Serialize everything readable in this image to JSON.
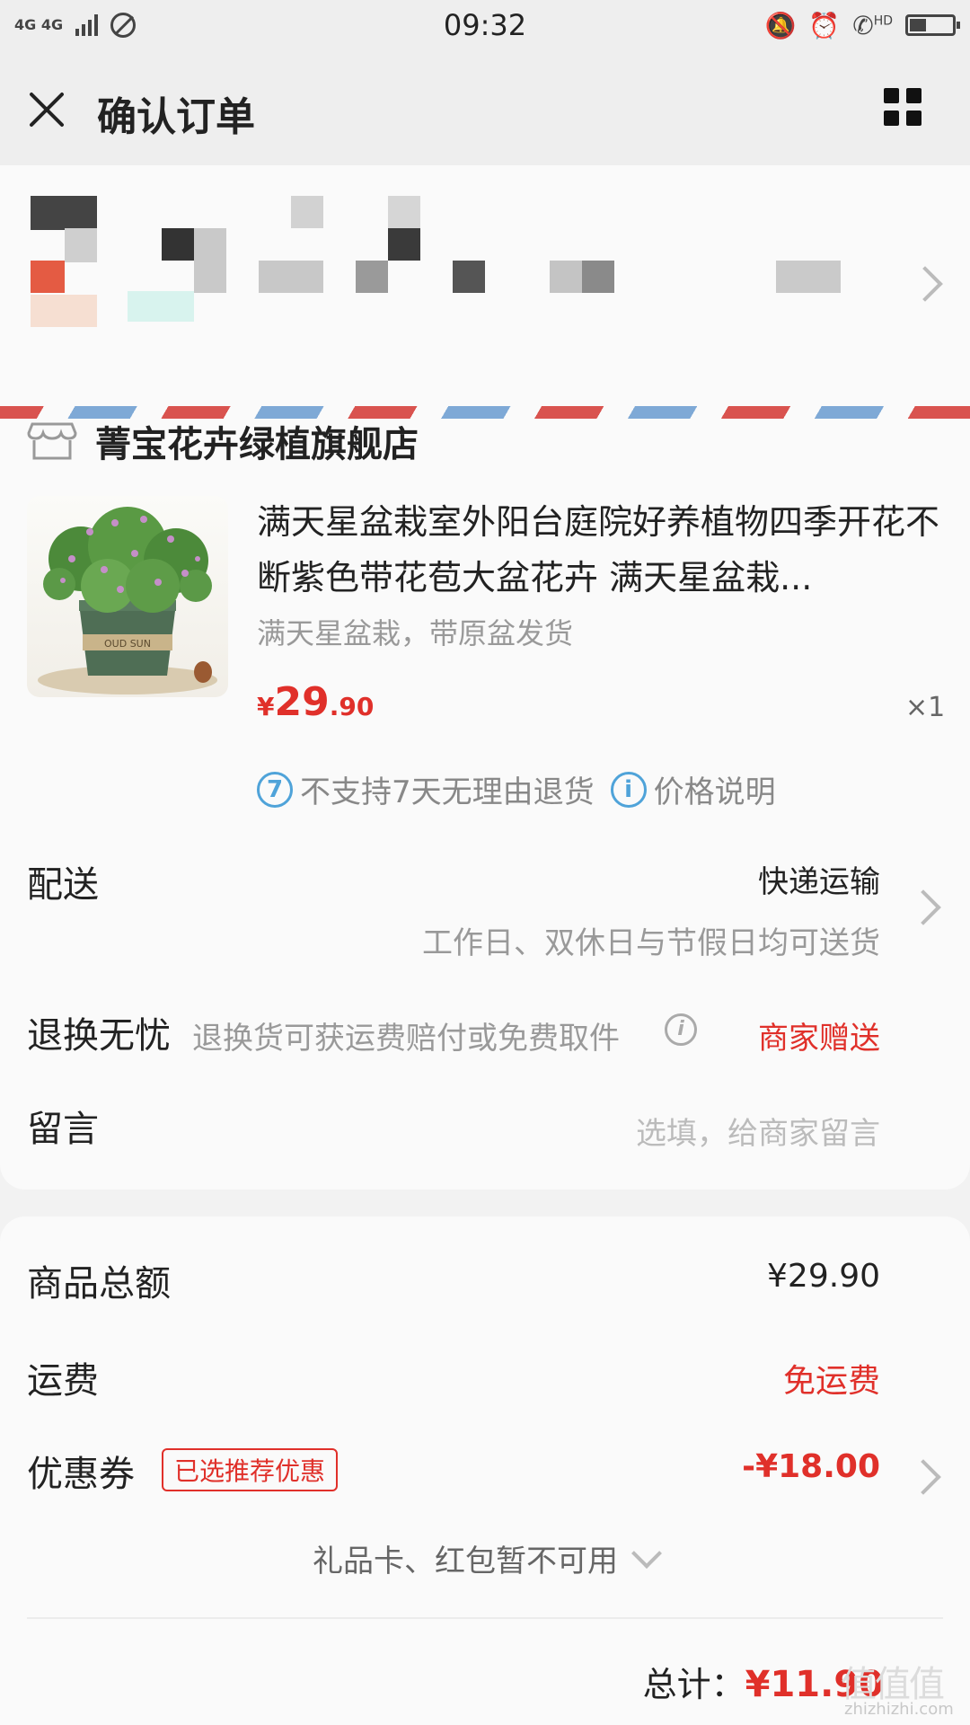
{
  "status_bar": {
    "network": "4G 4G",
    "time": "09:32",
    "hd": "HD"
  },
  "header": {
    "title": "确认订单"
  },
  "shop": {
    "name": "菁宝花卉绿植旗舰店"
  },
  "product": {
    "title": "满天星盆栽室外阳台庭院好养植物四季开花不断紫色带花苞大盆花卉 满天星盆栽...",
    "sku": "满天星盆栽，带原盆发货",
    "price_currency": "¥",
    "price_int": "29",
    "price_dec": ".90",
    "quantity": "×1",
    "pot_text": "OUD SUN"
  },
  "services": [
    {
      "label": "不支持7天无理由退货",
      "icon": "no-return-icon"
    },
    {
      "label": "价格说明",
      "icon": "info-icon"
    }
  ],
  "delivery": {
    "label": "配送",
    "method": "快递运输",
    "note": "工作日、双休日与节假日均可送货"
  },
  "returns": {
    "label": "退换无忧",
    "desc": "退换货可获运费赔付或免费取件",
    "badge": "商家赠送"
  },
  "message": {
    "label": "留言",
    "placeholder": "选填，给商家留言"
  },
  "summary": {
    "goods_label": "商品总额",
    "goods_value": "¥29.90",
    "shipping_label": "运费",
    "shipping_value": "免运费",
    "coupon_label": "优惠券",
    "coupon_tag": "已选推荐优惠",
    "coupon_value": "-¥18.00",
    "gift_text": "礼品卡、红包暂不可用",
    "total_label": "总计：",
    "total_value": "¥11.90"
  },
  "watermark": {
    "brand": "值值值",
    "domain": "zhizhizhi.com"
  },
  "colors": {
    "accent": "#e0302a",
    "info_blue": "#4fa3d9",
    "background": "#f2f2f2"
  }
}
